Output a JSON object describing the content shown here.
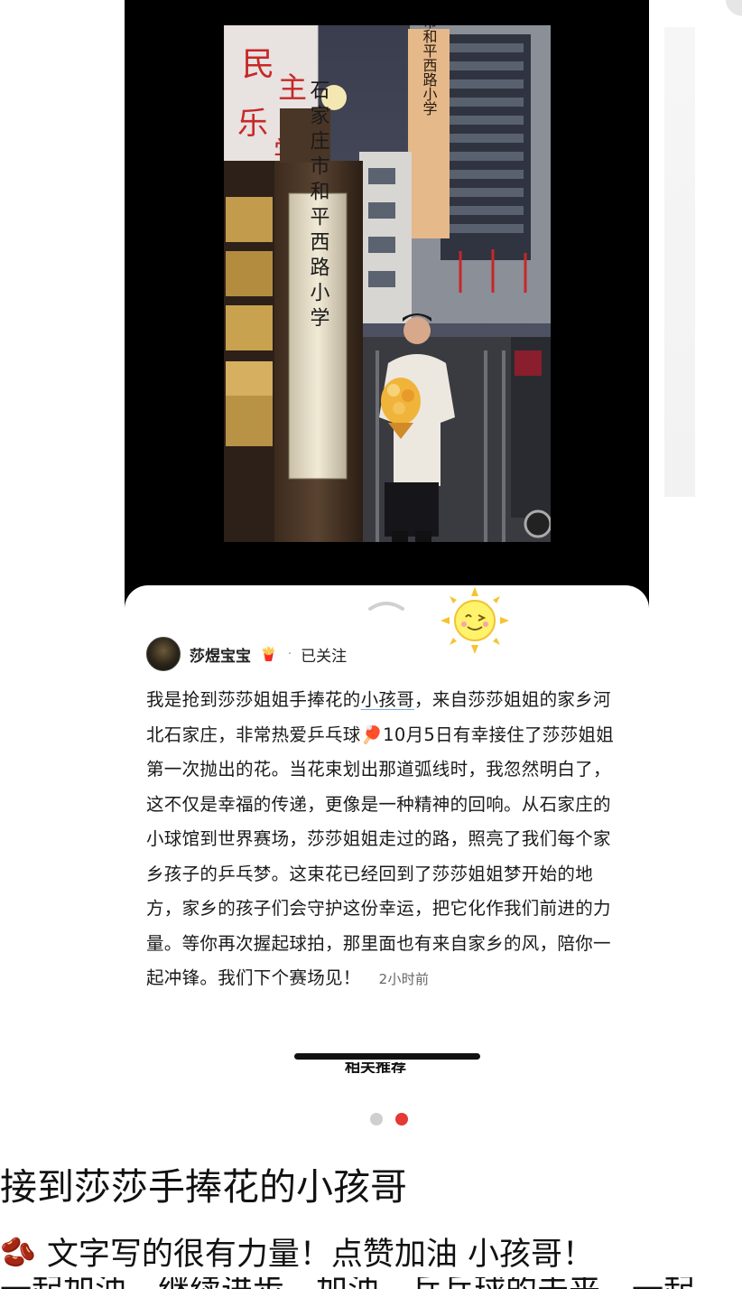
{
  "video": {
    "sign_vertical": "石家庄市和平西路小学",
    "sign_building": "石家庄市和平西路小学"
  },
  "post": {
    "author": "莎煜宝宝",
    "author_badge": "🍟",
    "separator": "·",
    "follow_state": "已关注",
    "text_before": "我是抢到莎莎姐姐手捧花的",
    "text_highlight": "小孩哥",
    "text_after": "，来自莎莎姐姐的家乡河北石家庄，非常热爱乒乓球🏓10月5日有幸接住了莎莎姐姐第一次抛出的花。当花束划出那道弧线时，我忽然明白了，这不仅是幸福的传递，更像是一种精神的回响。从石家庄的小球馆到世界赛场，莎莎姐姐走过的路，照亮了我们每个家乡孩子的乒乓梦。这束花已经回到了莎莎姐姐梦开始的地方，家乡的孩子们会守护这份幸运，把它化作我们前进的力量。等你再次握起球拍，那里面也有来自家乡的风，陪你一起冲锋。我们下个赛场见！",
    "time_ago": "2小时前",
    "related_label": "相关推荐"
  },
  "carousel": {
    "count": 2,
    "active": 2
  },
  "headline": "接到莎莎手捧花的小孩哥",
  "comment": {
    "emoji": "🫘",
    "text": "文字写的很有力量！点赞加油 小孩哥！"
  },
  "cut_line": "一起加油，继续进步，加油，乒乓球的未来，一起",
  "colors": {
    "accent_red": "#e53935",
    "sheet_bg": "#ffffff",
    "phone_bg": "#000000"
  },
  "icons": {
    "handle": "chevron-up-icon",
    "sticker": "sun-sticker-icon"
  }
}
